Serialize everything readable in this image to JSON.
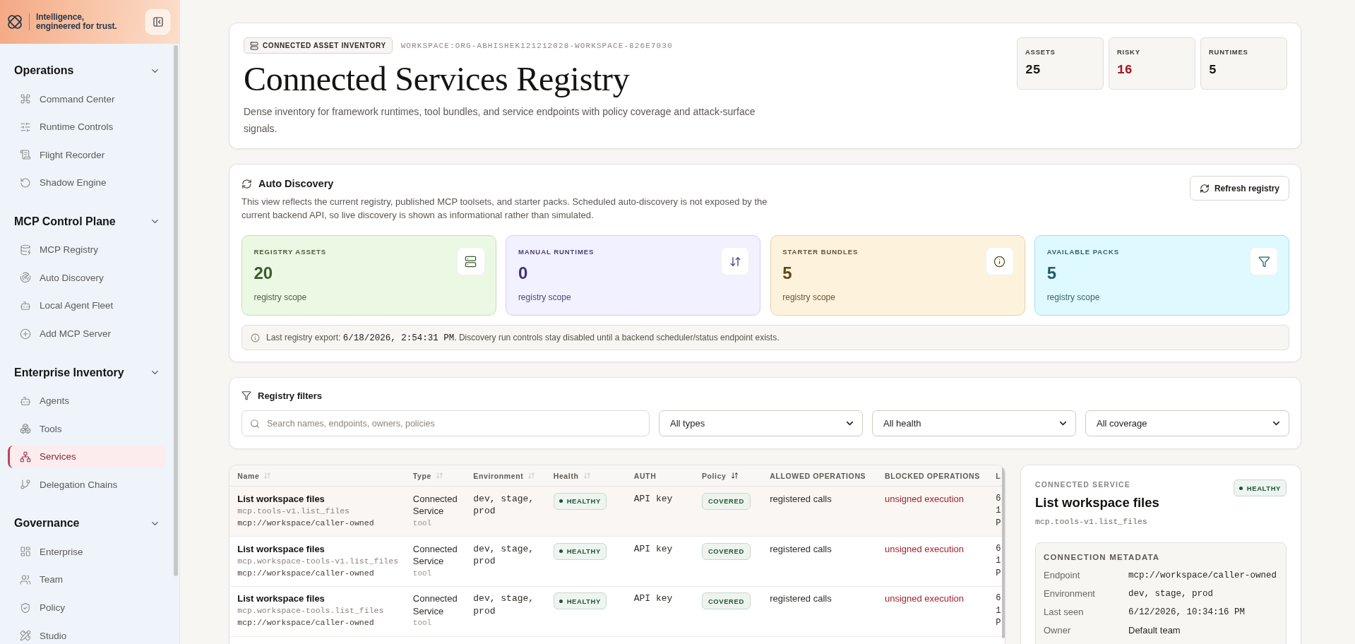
{
  "sidebar": {
    "tagline": "Intelligence, engineered for trust.",
    "sections": [
      {
        "title": "Operations",
        "expanded": true,
        "items": [
          {
            "label": "Command Center",
            "selected": false
          },
          {
            "label": "Runtime Controls",
            "selected": false
          },
          {
            "label": "Flight Recorder",
            "selected": false
          },
          {
            "label": "Shadow Engine",
            "selected": false
          }
        ]
      },
      {
        "title": "MCP Control Plane",
        "expanded": true,
        "items": [
          {
            "label": "MCP Registry",
            "selected": false
          },
          {
            "label": "Auto Discovery",
            "selected": false
          },
          {
            "label": "Local Agent Fleet",
            "selected": false
          },
          {
            "label": "Add MCP Server",
            "selected": false
          }
        ]
      },
      {
        "title": "Enterprise Inventory",
        "expanded": true,
        "items": [
          {
            "label": "Agents",
            "selected": false
          },
          {
            "label": "Tools",
            "selected": false
          },
          {
            "label": "Services",
            "selected": true
          },
          {
            "label": "Delegation Chains",
            "selected": false
          }
        ]
      },
      {
        "title": "Governance",
        "expanded": true,
        "items": [
          {
            "label": "Enterprise",
            "selected": false
          },
          {
            "label": "Team",
            "selected": false
          },
          {
            "label": "Policy",
            "selected": false
          },
          {
            "label": "Studio",
            "selected": false
          }
        ]
      }
    ]
  },
  "header": {
    "badge": "CONNECTED ASSET INVENTORY",
    "workspace": "WORKSPACE:ORG-ABHISHEK121212028-WORKSPACE-826E7030",
    "title": "Connected Services Registry",
    "description": "Dense inventory for framework runtimes, tool bundles, and service endpoints with policy coverage and attack-surface signals.",
    "stats": [
      {
        "label": "ASSETS",
        "value": "25",
        "color": "#1c1a18"
      },
      {
        "label": "RISKY",
        "value": "16",
        "color": "#9b1b27"
      },
      {
        "label": "RUNTIMES",
        "value": "5",
        "color": "#1c1a18"
      }
    ]
  },
  "discovery": {
    "title": "Auto Discovery",
    "description": "This view reflects the current registry, published MCP toolsets, and starter packs. Scheduled auto-discovery is not exposed by the current backend API, so live discovery is shown as informational rather than simulated.",
    "refresh_button": "Refresh registry",
    "tiles": [
      {
        "label": "REGISTRY ASSETS",
        "value": "20",
        "caption": "registry scope",
        "color": "#3f5a2c"
      },
      {
        "label": "MANUAL RUNTIMES",
        "value": "0",
        "caption": "registry scope",
        "color": "#40337a"
      },
      {
        "label": "STARTER BUNDLES",
        "value": "5",
        "caption": "registry scope",
        "color": "#5f4a18"
      },
      {
        "label": "AVAILABLE PACKS",
        "value": "5",
        "caption": "registry scope",
        "color": "#1f5c68"
      }
    ],
    "notice": {
      "prefix": "Last registry export: ",
      "timestamp": "6/18/2026, 2:54:31 PM",
      "suffix": ". Discovery run controls stay disabled until a backend scheduler/status endpoint exists."
    }
  },
  "filters": {
    "title": "Registry filters",
    "search": {
      "placeholder": "Search names, endpoints, owners, policies"
    },
    "selects": [
      "All types",
      "All health",
      "All coverage"
    ]
  },
  "table": {
    "columns": [
      {
        "label": "Name",
        "sortable": true,
        "sorted": false
      },
      {
        "label": "Type",
        "sortable": true,
        "sorted": false
      },
      {
        "label": "Environment",
        "sortable": true,
        "sorted": false
      },
      {
        "label": "Health",
        "sortable": true,
        "sorted": false
      },
      {
        "label": "AUTH",
        "sortable": false
      },
      {
        "label": "Policy",
        "sortable": true,
        "sorted": true
      },
      {
        "label": "ALLOWED OPERATIONS",
        "sortable": false
      },
      {
        "label": "BLOCKED OPERATIONS",
        "sortable": false
      },
      {
        "label": "L",
        "sortable": false
      }
    ],
    "rows": [
      {
        "selected": true,
        "name": "List workspace files",
        "identifier": "mcp.tools-v1.list_files",
        "endpoint": "mcp://workspace/caller-owned",
        "type": "Connected Service",
        "type_detail": "tool",
        "environment": "dev, stage, prod",
        "health": "HEALTHY",
        "auth": "API key",
        "policy": "COVERED",
        "allowed": "registered calls",
        "blocked": "unsigned execution",
        "column_9": [
          "6",
          "1",
          "P"
        ]
      },
      {
        "selected": false,
        "name": "List workspace files",
        "identifier": "mcp.workspace-tools-v1.list_files",
        "endpoint": "mcp://workspace/caller-owned",
        "type": "Connected Service",
        "type_detail": "tool",
        "environment": "dev, stage, prod",
        "health": "HEALTHY",
        "auth": "API key",
        "policy": "COVERED",
        "allowed": "registered calls",
        "blocked": "unsigned execution",
        "column_9": [
          "6",
          "1",
          "P"
        ]
      },
      {
        "selected": false,
        "name": "List workspace files",
        "identifier": "mcp.workspace-tools.list_files",
        "endpoint": "mcp://workspace/caller-owned",
        "type": "Connected Service",
        "type_detail": "tool",
        "environment": "dev, stage, prod",
        "health": "HEALTHY",
        "auth": "API key",
        "policy": "COVERED",
        "allowed": "registered calls",
        "blocked": "unsigned execution",
        "column_9": [
          "6",
          "1",
          "P"
        ]
      }
    ]
  },
  "detail": {
    "eyebrow": "CONNECTED SERVICE",
    "title": "List workspace files",
    "identifier": "mcp.tools-v1.list_files",
    "health": "HEALTHY",
    "metadata": {
      "title": "CONNECTION METADATA",
      "rows": [
        {
          "label": "Endpoint",
          "value": "mcp://workspace/caller-owned",
          "kind": "code"
        },
        {
          "label": "Environment",
          "value": "dev, stage, prod",
          "kind": "code"
        },
        {
          "label": "Last seen",
          "value": "6/12/2026, 10:34:16 PM",
          "kind": "code"
        },
        {
          "label": "Owner",
          "value": "Default team",
          "kind": "text"
        }
      ]
    }
  }
}
